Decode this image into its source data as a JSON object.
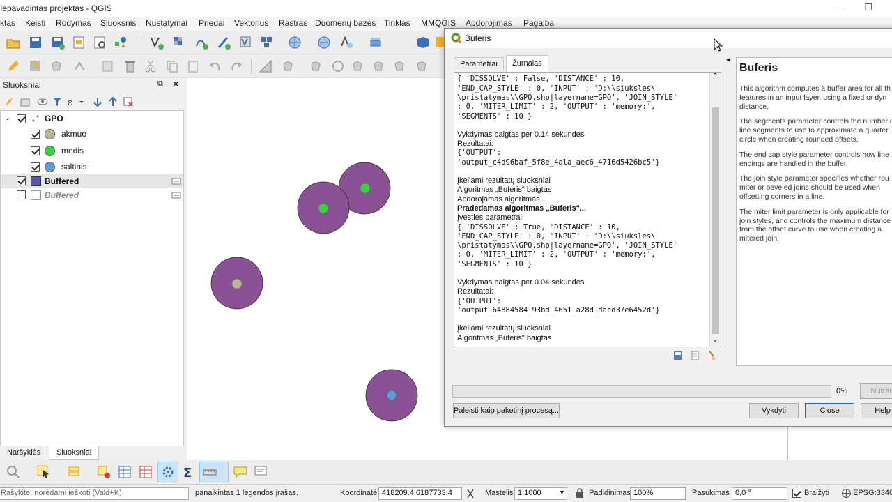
{
  "window": {
    "title": "Iepavadintas projektas - QGIS"
  },
  "menu": [
    "ktas",
    "Keisti",
    "Rodymas",
    "Sluoksnis",
    "Nustatymai",
    "Priedai",
    "Vektorius",
    "Rastras",
    "Duomenų bazės",
    "Tinklas",
    "MMQGIS",
    "Apdorojimas",
    "Pagalba"
  ],
  "layers_panel": {
    "title": "Sluoksniai",
    "group": {
      "name": "GPO",
      "checked": true
    },
    "items": [
      {
        "name": "akmuo",
        "color": "#bfb69a",
        "checked": true
      },
      {
        "name": "medis",
        "color": "#39d13d",
        "checked": true
      },
      {
        "name": "saltinis",
        "color": "#5b9bdc",
        "checked": true
      }
    ],
    "buffered_layers": [
      {
        "name": "Buffered",
        "color": "#5d55a8",
        "checked": true,
        "style": "bold-underline"
      },
      {
        "name": "Buffered",
        "color": "#ffffff",
        "checked": false,
        "style": "italic-gray"
      }
    ],
    "tabs": [
      "Naršyklės",
      "Sluoksniai"
    ]
  },
  "map": {
    "buffer_color": "#8a5294"
  },
  "dialog": {
    "title": "Buferis",
    "tabs": [
      "Parametrai",
      "Žurnalas"
    ],
    "active_tab": "Žurnalas",
    "log": [
      {
        "text": "Įvesties parametrai:",
        "style": "cut"
      },
      {
        "text": "{ 'DISSOLVE' : False, 'DISTANCE' : 10,",
        "style": "mono"
      },
      {
        "text": "'END_CAP_STYLE' : 0, 'INPUT' : 'D:\\\\siuksles\\",
        "style": "mono"
      },
      {
        "text": "\\pristatymas\\\\GPO.shp|layername=GPO', 'JOIN_STYLE'",
        "style": "mono"
      },
      {
        "text": ": 0, 'MITER_LIMIT' : 2, 'OUTPUT' : 'memory:',",
        "style": "mono"
      },
      {
        "text": "'SEGMENTS' : 10 }",
        "style": "mono"
      },
      {
        "text": "",
        "style": "gap"
      },
      {
        "text": "Vykdymas baigtas per 0.14 sekundes",
        "style": "sans"
      },
      {
        "text": "Rezultatai:",
        "style": "sans"
      },
      {
        "text": "{'OUTPUT':",
        "style": "mono"
      },
      {
        "text": "'output_c4d96baf_5f8e_4ala_aec6_4716d5426bc5'}",
        "style": "mono"
      },
      {
        "text": "",
        "style": "gap"
      },
      {
        "text": "Įkeliami rezultatų sluoksniai",
        "style": "sans"
      },
      {
        "text": "Algoritmas „Buferis\" baigtas",
        "style": "sans"
      },
      {
        "text": "Apdorojamas algoritmas...",
        "style": "sans"
      },
      {
        "text": "Pradedamas algoritmas „Buferis\"...",
        "style": "bold"
      },
      {
        "text": "Įvesties parametrai:",
        "style": "sans"
      },
      {
        "text": "{ 'DISSOLVE' : True, 'DISTANCE' : 10,",
        "style": "mono"
      },
      {
        "text": "'END_CAP_STYLE' : 0, 'INPUT' : 'D:\\\\siuksles\\",
        "style": "mono"
      },
      {
        "text": "\\pristatymas\\\\GPO.shp|layername=GPO', 'JOIN_STYLE'",
        "style": "mono"
      },
      {
        "text": ": 0, 'MITER_LIMIT' : 2, 'OUTPUT' : 'memory:',",
        "style": "mono"
      },
      {
        "text": "'SEGMENTS' : 10 }",
        "style": "mono"
      },
      {
        "text": "",
        "style": "gap"
      },
      {
        "text": "Vykdymas baigtas per 0.04 sekundes",
        "style": "sans"
      },
      {
        "text": "Rezultatai:",
        "style": "sans"
      },
      {
        "text": "{'OUTPUT':",
        "style": "mono"
      },
      {
        "text": "'output_64884584_93bd_4651_a28d_dacd37e6452d'}",
        "style": "mono"
      },
      {
        "text": "",
        "style": "gap"
      },
      {
        "text": "Įkeliami rezultatų sluoksniai",
        "style": "sans"
      },
      {
        "text": "Algoritmas „Buferis\" baigtas",
        "style": "sans"
      }
    ],
    "help": {
      "title": "Buferis",
      "lines": [
        "This algorithm computes a buffer area for all th",
        "features in an input layer, using a fixed or dyn",
        "distance.",
        "",
        "The segments parameter controls the number o",
        "line segments to use to approximate a quarter",
        "circle when creating rounded offsets.",
        "",
        "The end cap style parameter controls how line",
        "endings are handled in the buffer.",
        "",
        "The join style parameter specifies whether rou",
        "miter or beveled joins should be used when",
        "offsetting corners in a line.",
        "",
        "The miter limit parameter is only applicable for",
        "join styles, and controls the maximum distance",
        "from the offset curve to use when creating a",
        "mitered join."
      ]
    },
    "progress_percent": "0%",
    "progress_value": 0,
    "buttons": {
      "cancel": "Nutrau",
      "batch": "Paleisti kaip paketinį procesą...",
      "run": "Vykdyti",
      "close": "Close",
      "help": "Help"
    }
  },
  "statusbar": {
    "search_placeholder": "Rašykite, norėdami ieškoti (Vald+K)",
    "message": "panaikintas 1 legendos įrašas.",
    "coordinate_label": "Koordinatė",
    "coordinate": "418209.4,6187733.4",
    "scale_label": "Mastelis",
    "scale": "1:1000",
    "magnifier_label": "Padidinimas",
    "magnifier": "100%",
    "rotation_label": "Pasukimas",
    "rotation": "0,0 °",
    "render_label": "Braižyti",
    "crs": "EPSG:3346"
  }
}
